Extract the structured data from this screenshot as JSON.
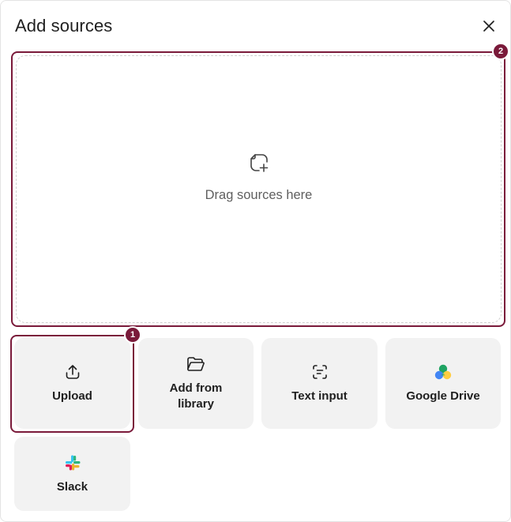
{
  "dialog": {
    "title": "Add sources",
    "close_icon": "close-icon"
  },
  "dropzone": {
    "label": "Drag sources here",
    "icon": "add-source-icon",
    "badge": "2"
  },
  "sources": {
    "upload": {
      "label": "Upload",
      "icon": "upload-icon",
      "badge": "1"
    },
    "library": {
      "label": "Add from library",
      "icon": "folder-open-icon"
    },
    "text_input": {
      "label": "Text input",
      "icon": "text-input-icon"
    },
    "google_drive": {
      "label": "Google Drive",
      "icon": "google-drive-icon"
    },
    "slack": {
      "label": "Slack",
      "icon": "slack-icon"
    }
  },
  "colors": {
    "accent": "#7a1a3a",
    "tile_bg": "#f2f2f2",
    "dashed_border": "#cfcfcf"
  }
}
